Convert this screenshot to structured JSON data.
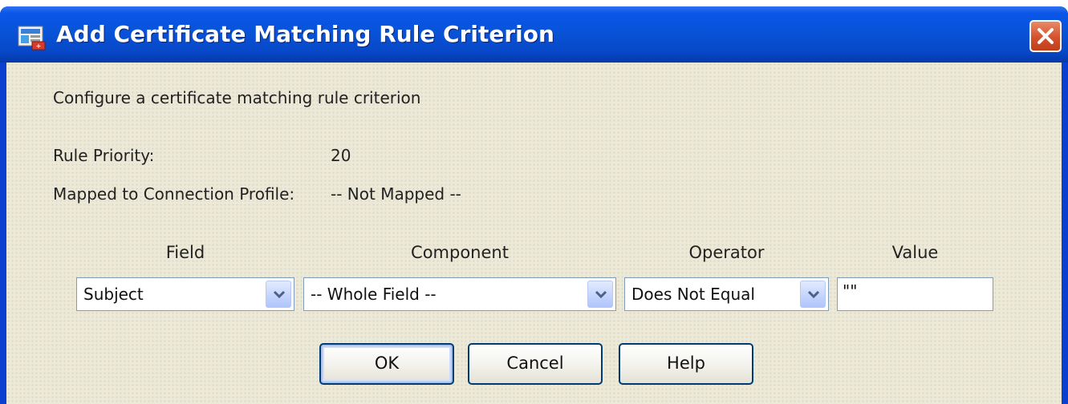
{
  "dialog": {
    "title": "Add Certificate Matching Rule Criterion",
    "description": "Configure a certificate matching rule criterion",
    "rule_priority_label": "Rule Priority:",
    "rule_priority_value": "20",
    "mapped_label": "Mapped to Connection Profile:",
    "mapped_value": "-- Not Mapped --"
  },
  "columns": {
    "field": "Field",
    "component": "Component",
    "operator": "Operator",
    "value": "Value"
  },
  "inputs": {
    "field_selected": "Subject",
    "component_selected": "-- Whole Field --",
    "operator_selected": "Does Not Equal",
    "value_text": "\"\""
  },
  "buttons": {
    "ok": "OK",
    "cancel": "Cancel",
    "help": "Help"
  },
  "icons": {
    "app": "asdm-app-icon",
    "close": "close-icon",
    "dropdown": "chevron-down-icon"
  },
  "colors": {
    "titlebar": "#0853d8",
    "client_bg": "#ece9d8",
    "close_button": "#d4512c",
    "button_border": "#003c74"
  }
}
